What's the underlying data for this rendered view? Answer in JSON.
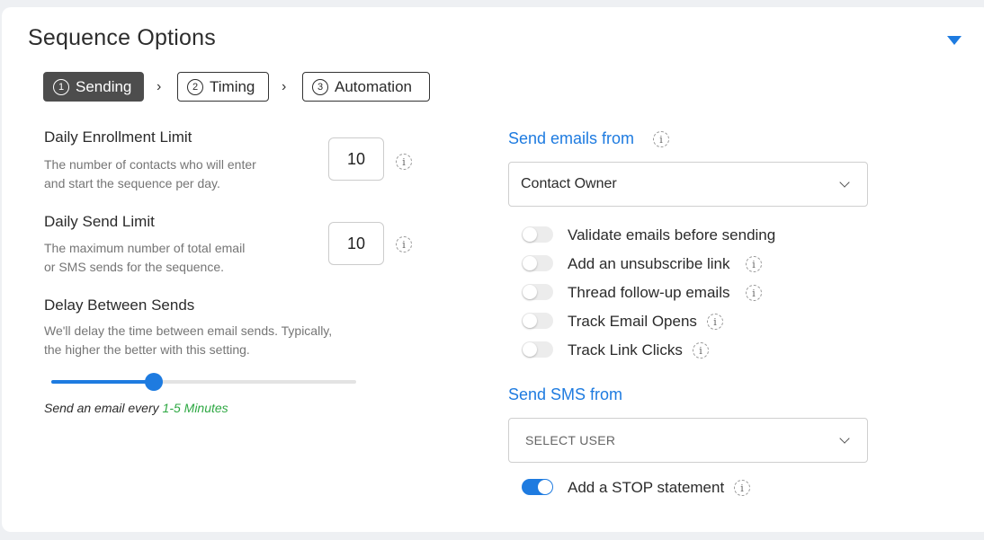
{
  "header": {
    "title": "Sequence Options"
  },
  "steps": [
    {
      "num": "1",
      "label": "Sending"
    },
    {
      "num": "2",
      "label": "Timing"
    },
    {
      "num": "3",
      "label": "Automation"
    }
  ],
  "enrollment": {
    "label": "Daily Enrollment Limit",
    "desc_line1": "The number of contacts who will enter",
    "desc_line2": "and start the sequence per day.",
    "value": "10"
  },
  "send_limit": {
    "label": "Daily Send Limit",
    "desc_line1": "The maximum number of total email",
    "desc_line2": "or SMS sends for the sequence.",
    "value": "10"
  },
  "delay": {
    "label": "Delay Between Sends",
    "desc_line1": "We'll delay the time between email sends. Typically,",
    "desc_line2": "the higher the better with this setting.",
    "slider_fraction": 0.335,
    "caption_prefix": "Send an email every ",
    "caption_value": "1-5 Minutes"
  },
  "email_from": {
    "title": "Send emails from",
    "selected": "Contact Owner"
  },
  "toggles": [
    {
      "label": "Validate emails before sending",
      "on": false,
      "info": false
    },
    {
      "label": "Add an unsubscribe link",
      "on": false,
      "info": true
    },
    {
      "label": "Thread follow-up emails",
      "on": false,
      "info": true
    },
    {
      "label": "Track Email Opens",
      "on": false,
      "info": true
    },
    {
      "label": "Track Link Clicks",
      "on": false,
      "info": true
    }
  ],
  "sms_from": {
    "title": "Send SMS from",
    "placeholder": "SELECT USER"
  },
  "stop_toggle": {
    "label": "Add a STOP statement",
    "on": true
  },
  "icons": {
    "info": "info-icon",
    "collapse": "triangle-down-icon",
    "chevron": "chevron-right-icon",
    "caret": "chevron-down-icon"
  },
  "colors": {
    "accent": "#1e7be0",
    "highlight": "#2ea843",
    "active_step": "#4d4d4d"
  }
}
